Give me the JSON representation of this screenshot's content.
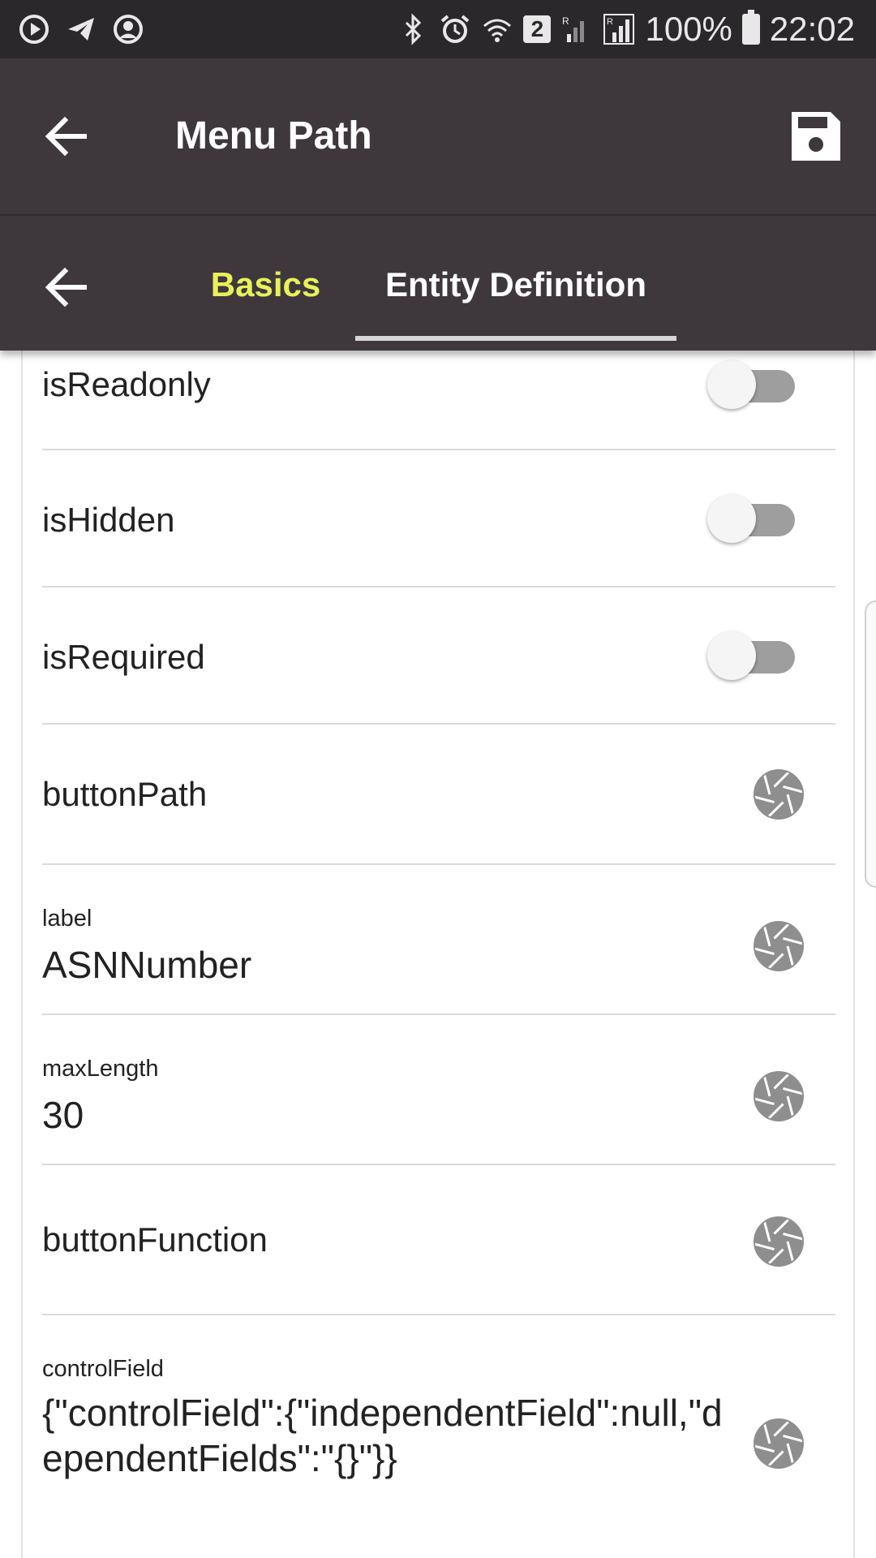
{
  "status_bar": {
    "battery": "100%",
    "time": "22:02",
    "notification_badge": "2",
    "left_icons": [
      "play-circle-icon",
      "telegram-icon",
      "account-circle-icon"
    ],
    "right_icons": [
      "bluetooth-icon",
      "alarm-icon",
      "wifi-icon",
      "signal-roaming-icon",
      "signal-roaming-icon",
      "battery-icon"
    ]
  },
  "app_bar": {
    "title": "Menu Path",
    "back_icon": "arrow-back-icon",
    "save_icon": "save-icon"
  },
  "tabs": {
    "back_icon": "arrow-back-icon",
    "items": [
      {
        "label": "Basics"
      },
      {
        "label": "Entity Definition"
      }
    ],
    "active_color": "#e9f05b"
  },
  "fields": {
    "isReadonly": {
      "label": "isReadonly",
      "on": false
    },
    "isHidden": {
      "label": "isHidden",
      "on": false
    },
    "isRequired": {
      "label": "isRequired",
      "on": false
    },
    "buttonPath": {
      "label": "buttonPath"
    },
    "label": {
      "label": "label",
      "value": "ASNNumber"
    },
    "maxLength": {
      "label": "maxLength",
      "value": "30"
    },
    "buttonFunction": {
      "label": "buttonFunction"
    },
    "controlField": {
      "label": "controlField",
      "value": "{\"controlField\":{\"independentField\":null,\"dependentFields\":\"{}\"}}"
    }
  },
  "colors": {
    "status_bar_bg": "#2b282c",
    "app_bar_bg": "#3e383d",
    "tab_active_text": "#e9f05b",
    "tab_text": "#ffffff",
    "icon_gray": "#8e8e8e"
  }
}
